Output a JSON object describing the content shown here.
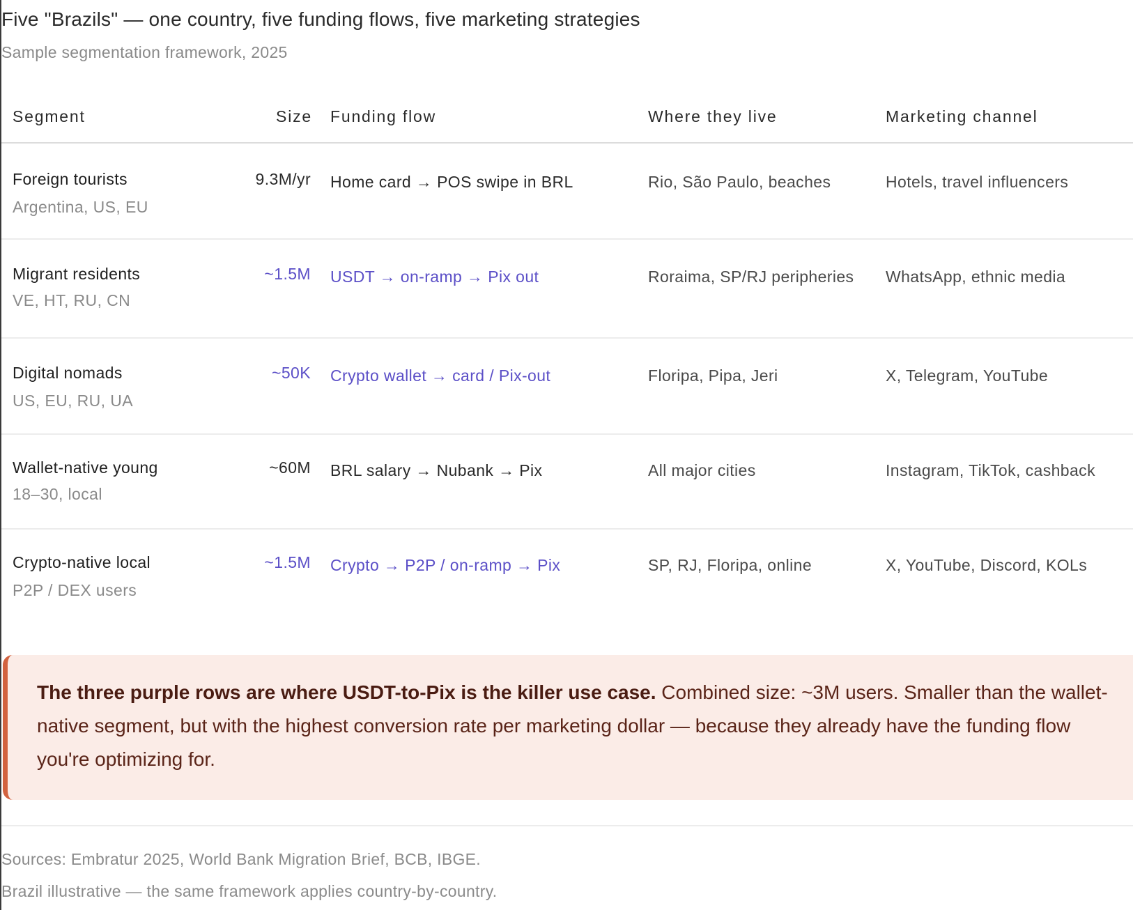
{
  "header": {
    "title": "Five \"Brazils\" — one country, five funding flows, five marketing strategies",
    "subtitle": "Sample segmentation framework, 2025"
  },
  "table": {
    "columns": [
      "Segment",
      "Size",
      "Funding flow",
      "Where they live",
      "Marketing channel"
    ],
    "rows": [
      {
        "segment": "Foreign tourists",
        "segment_sub": "Argentina, US, EU",
        "size": "9.3M/yr",
        "funding_flow": "Home card → POS swipe in BRL",
        "where": "Rio, São Paulo, beaches",
        "channel": "Hotels, travel influencers",
        "highlight": false
      },
      {
        "segment": "Migrant residents",
        "segment_sub": "VE, HT, RU, CN",
        "size": "~1.5M",
        "funding_flow": "USDT → on-ramp → Pix out",
        "where": "Roraima, SP/RJ peripheries",
        "channel": "WhatsApp, ethnic media",
        "highlight": true
      },
      {
        "segment": "Digital nomads",
        "segment_sub": "US, EU, RU, UA",
        "size": "~50K",
        "funding_flow": "Crypto wallet → card / Pix-out",
        "where": "Floripa, Pipa, Jeri",
        "channel": "X, Telegram, YouTube",
        "highlight": true
      },
      {
        "segment": "Wallet-native young",
        "segment_sub": "18–30, local",
        "size": "~60M",
        "funding_flow": "BRL salary → Nubank → Pix",
        "where": "All major cities",
        "channel": "Instagram, TikTok, cashback",
        "highlight": false
      },
      {
        "segment": "Crypto-native local",
        "segment_sub": "P2P / DEX users",
        "size": "~1.5M",
        "funding_flow": "Crypto → P2P / on-ramp → Pix",
        "where": "SP, RJ, Floripa, online",
        "channel": "X, YouTube, Discord, KOLs",
        "highlight": true
      }
    ]
  },
  "callout": {
    "bold": "The three purple rows are where USDT-to-Pix is the killer use case.",
    "text": " Combined size: ~3M users. Smaller than the wallet-native segment, but with the highest conversion rate per marketing dollar — because they already have the funding flow you're optimizing for."
  },
  "footer": {
    "sources": "Sources: Embratur 2025, World Bank Migration Brief, BCB, IBGE.",
    "note": "Brazil illustrative — the same framework applies country-by-country."
  },
  "colors": {
    "highlight": "#5b4fc7",
    "callout_bg": "#fbece7",
    "callout_border": "#d2623f"
  }
}
